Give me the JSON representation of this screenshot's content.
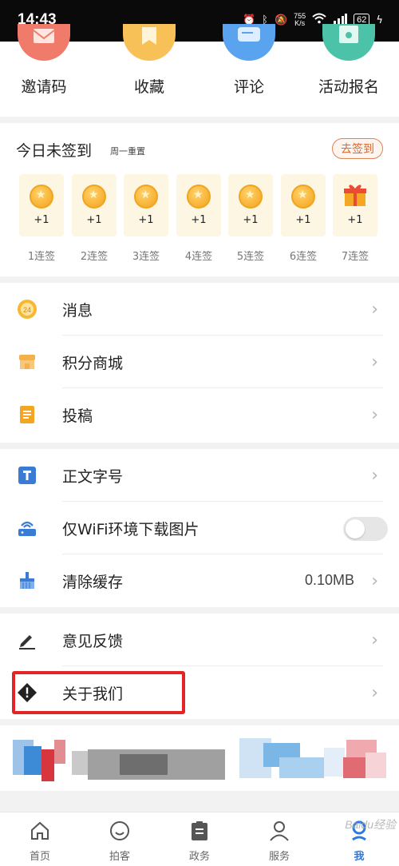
{
  "status_bar": {
    "time": "14:43",
    "net_speed_top": "755",
    "net_speed_bottom": "K/s",
    "battery": "62"
  },
  "shortcuts": [
    {
      "label": "邀请码",
      "icon": "invite-icon",
      "color": "#f07b6a"
    },
    {
      "label": "收藏",
      "icon": "bookmark-icon",
      "color": "#f7c158"
    },
    {
      "label": "评论",
      "icon": "comment-icon",
      "color": "#5aa3ee"
    },
    {
      "label": "活动报名",
      "icon": "activity-icon",
      "color": "#4cc3a8"
    }
  ],
  "signin": {
    "title": "今日未签到",
    "subtitle": "周一重置",
    "button": "去签到",
    "days": [
      {
        "reward": "+1",
        "label": "1连签",
        "icon": "coin-icon"
      },
      {
        "reward": "+1",
        "label": "2连签",
        "icon": "coin-icon"
      },
      {
        "reward": "+1",
        "label": "3连签",
        "icon": "coin-icon"
      },
      {
        "reward": "+1",
        "label": "4连签",
        "icon": "coin-icon"
      },
      {
        "reward": "+1",
        "label": "5连签",
        "icon": "coin-icon"
      },
      {
        "reward": "+1",
        "label": "6连签",
        "icon": "coin-icon"
      },
      {
        "reward": "+1",
        "label": "7连签",
        "icon": "gift-icon"
      }
    ]
  },
  "menu1": [
    {
      "label": "消息",
      "icon": "message-icon"
    },
    {
      "label": "积分商城",
      "icon": "store-icon"
    },
    {
      "label": "投稿",
      "icon": "submit-icon"
    }
  ],
  "menu2": [
    {
      "label": "正文字号",
      "icon": "font-size-icon"
    },
    {
      "label": "仅WiFi环境下载图片",
      "icon": "wifi-router-icon",
      "toggle": "off"
    },
    {
      "label": "清除缓存",
      "icon": "broom-icon",
      "value": "0.10MB"
    }
  ],
  "menu3": [
    {
      "label": "意见反馈",
      "icon": "feedback-pen-icon"
    },
    {
      "label": "关于我们",
      "icon": "info-diamond-icon"
    }
  ],
  "tabs": [
    {
      "label": "首页",
      "icon": "home-icon"
    },
    {
      "label": "拍客",
      "icon": "smile-icon"
    },
    {
      "label": "政务",
      "icon": "clipboard-icon"
    },
    {
      "label": "服务",
      "icon": "person-icon"
    },
    {
      "label": "我",
      "icon": "me-icon",
      "active": true
    }
  ],
  "watermark": "Baidu经验",
  "colors": {
    "accent": "#2a7ae2",
    "highlight": "#e32424",
    "signin_button": "#d9672e"
  }
}
